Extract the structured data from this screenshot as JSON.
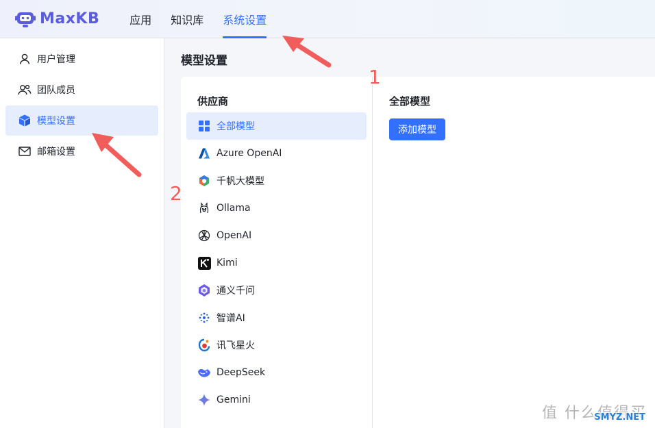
{
  "app": {
    "name": "MaxKB"
  },
  "nav": {
    "items": [
      {
        "label": "应用",
        "active": false
      },
      {
        "label": "知识库",
        "active": false
      },
      {
        "label": "系统设置",
        "active": true
      }
    ]
  },
  "sidebar": {
    "items": [
      {
        "label": "用户管理",
        "icon": "user-icon",
        "active": false
      },
      {
        "label": "团队成员",
        "icon": "team-icon",
        "active": false
      },
      {
        "label": "模型设置",
        "icon": "cube-icon",
        "active": true
      },
      {
        "label": "邮箱设置",
        "icon": "mail-icon",
        "active": false
      }
    ]
  },
  "main": {
    "page_title": "模型设置",
    "provider_title": "供应商",
    "providers": [
      {
        "label": "全部模型",
        "icon": "grid-icon",
        "active": true
      },
      {
        "label": "Azure OpenAI",
        "icon": "azure-icon"
      },
      {
        "label": "千帆大模型",
        "icon": "qianfan-icon"
      },
      {
        "label": "Ollama",
        "icon": "ollama-icon"
      },
      {
        "label": "OpenAI",
        "icon": "openai-icon"
      },
      {
        "label": "Kimi",
        "icon": "kimi-icon"
      },
      {
        "label": "通义千问",
        "icon": "tongyi-icon"
      },
      {
        "label": "智谱AI",
        "icon": "zhipu-icon"
      },
      {
        "label": "讯飞星火",
        "icon": "xunfei-icon"
      },
      {
        "label": "DeepSeek",
        "icon": "deepseek-icon"
      },
      {
        "label": "Gemini",
        "icon": "gemini-icon"
      }
    ],
    "models_title": "全部模型",
    "add_button": "添加模型"
  },
  "annotations": {
    "one": "1",
    "two": "2"
  },
  "watermark": {
    "text": "值 什么值得买",
    "site": "SMYZ.NET"
  },
  "colors": {
    "accent": "#3370ff",
    "brand": "#5a5ce0",
    "annotation": "#f15d5a"
  }
}
